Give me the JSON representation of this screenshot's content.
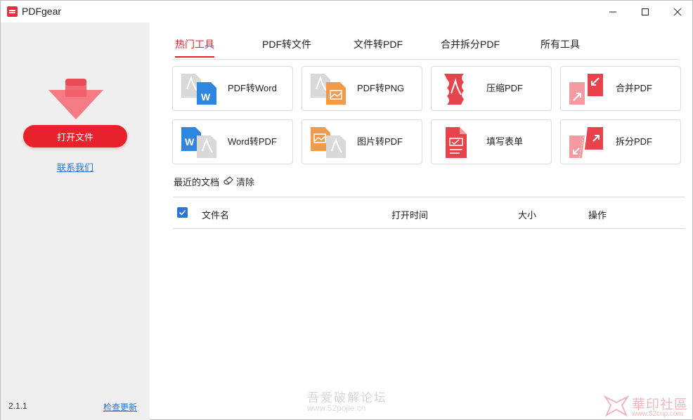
{
  "window": {
    "title": "PDFgear"
  },
  "sidebar": {
    "open_button": "打开文件",
    "contact_link": "联系我们",
    "version": "2.1.1",
    "update_link": "检查更新"
  },
  "tabs": [
    {
      "label": "热门工具"
    },
    {
      "label": "PDF转文件"
    },
    {
      "label": "文件转PDF"
    },
    {
      "label": "合并拆分PDF"
    },
    {
      "label": "所有工具"
    }
  ],
  "tools": [
    {
      "label": "PDF转Word",
      "icon": "pdf-to-word-icon"
    },
    {
      "label": "PDF转PNG",
      "icon": "pdf-to-png-icon"
    },
    {
      "label": "压缩PDF",
      "icon": "compress-pdf-icon"
    },
    {
      "label": "合并PDF",
      "icon": "merge-pdf-icon"
    },
    {
      "label": "Word转PDF",
      "icon": "word-to-pdf-icon"
    },
    {
      "label": "图片转PDF",
      "icon": "image-to-pdf-icon"
    },
    {
      "label": "填写表单",
      "icon": "fill-form-icon"
    },
    {
      "label": "拆分PDF",
      "icon": "split-pdf-icon"
    }
  ],
  "recent": {
    "title": "最近的文档",
    "clear": "清除"
  },
  "table": {
    "columns": [
      "文件名",
      "打开时间",
      "大小",
      "操作"
    ]
  },
  "watermarks": {
    "left_title": "吾爱破解论坛",
    "left_url": "www.52pojie.cn",
    "right_title": "華印社區",
    "right_url": "www.52cnp.com"
  },
  "colors": {
    "accent": "#e8222d",
    "link": "#2a74d8"
  }
}
